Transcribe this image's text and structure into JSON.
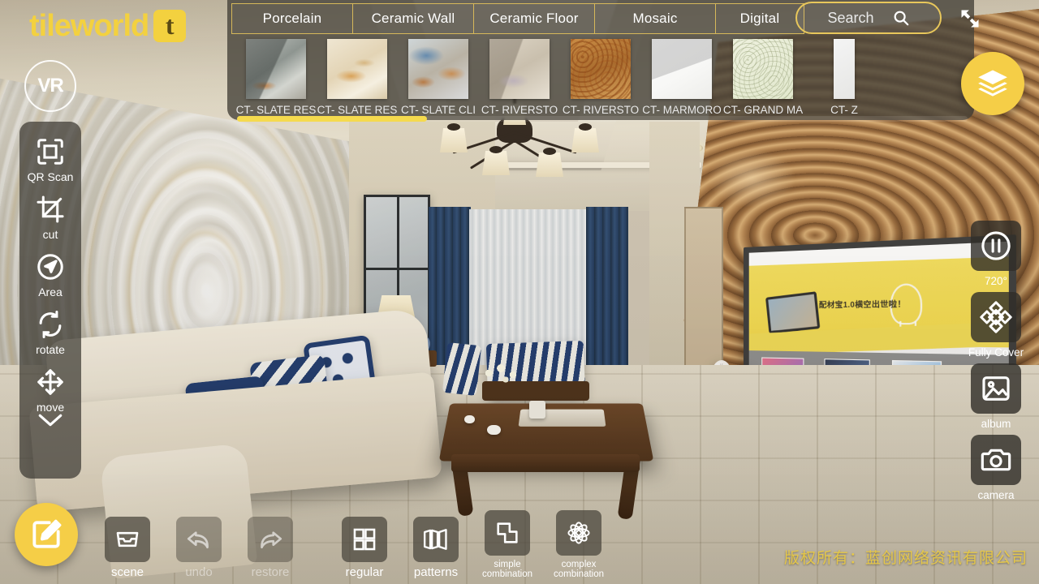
{
  "brand": {
    "name": "tileworld",
    "mark": "t",
    "vr_badge": "VR",
    "logo_color": "#f3d13f"
  },
  "top_panel": {
    "tabs": [
      {
        "label": "Porcelain",
        "active": true
      },
      {
        "label": "Ceramic Wall",
        "active": false
      },
      {
        "label": "Ceramic Floor",
        "active": false
      },
      {
        "label": "Mosaic",
        "active": false
      },
      {
        "label": "Digital",
        "active": false
      }
    ],
    "search": {
      "placeholder": "Search",
      "value": "",
      "icon": "search-icon"
    },
    "expand_icon": "expand-arrows-icon",
    "scrollbar": {
      "position_pct": 0,
      "thumb_width_pct": 26,
      "color": "#f5da4e"
    },
    "tiles": [
      {
        "label": "CT- SLATE RES",
        "swatch": "t1"
      },
      {
        "label": "CT- SLATE RES",
        "swatch": "t2"
      },
      {
        "label": "CT- SLATE CLI",
        "swatch": "t3"
      },
      {
        "label": "CT- RIVERSTO",
        "swatch": "t4"
      },
      {
        "label": "CT- RIVERSTO",
        "swatch": "t5"
      },
      {
        "label": "CT- MARMORO",
        "swatch": "t6"
      },
      {
        "label": "CT- GRAND MA",
        "swatch": "t7"
      },
      {
        "label": "CT- Z",
        "swatch": "t8"
      }
    ]
  },
  "left_toolbar": {
    "items": [
      {
        "label": "QR Scan",
        "icon": "qr-scan-icon"
      },
      {
        "label": "cut",
        "icon": "crop-icon"
      },
      {
        "label": "Area",
        "icon": "navigate-icon"
      },
      {
        "label": "rotate",
        "icon": "rotate-icon"
      },
      {
        "label": "move",
        "icon": "move-icon"
      }
    ],
    "collapse_icon": "chevron-down-icon"
  },
  "right_toolbar": {
    "items": [
      {
        "label": "720°",
        "icon": "pause-icon"
      },
      {
        "label": "Fully Cover",
        "icon": "fully-cover-icon"
      },
      {
        "label": "album",
        "icon": "image-icon"
      },
      {
        "label": "camera",
        "icon": "camera-icon"
      }
    ]
  },
  "bottom_toolbar": {
    "edit_fab": {
      "icon": "edit-pencil-icon",
      "color": "#f5ce47"
    },
    "items": [
      {
        "label": "scene",
        "icon": "tray-icon",
        "enabled": true
      },
      {
        "label": "undo",
        "icon": "undo-arrow-icon",
        "enabled": false
      },
      {
        "label": "restore",
        "icon": "redo-arrow-icon",
        "enabled": false
      },
      {
        "label": "regular",
        "icon": "grid-four-icon",
        "enabled": true
      },
      {
        "label": "patterns",
        "icon": "panels-icon",
        "enabled": true
      },
      {
        "label": "simple combination",
        "icon": "simple-combination-icon",
        "enabled": true
      },
      {
        "label": "complex combination",
        "icon": "complex-combination-icon",
        "enabled": true
      }
    ]
  },
  "layers_fab": {
    "icon": "layers-icon",
    "color": "#f5ce47"
  },
  "scene": {
    "tv_banner_text": "配材宝1.0横空出世啦！"
  },
  "watermark": "版权所有：蓝创网络资讯有限公司"
}
